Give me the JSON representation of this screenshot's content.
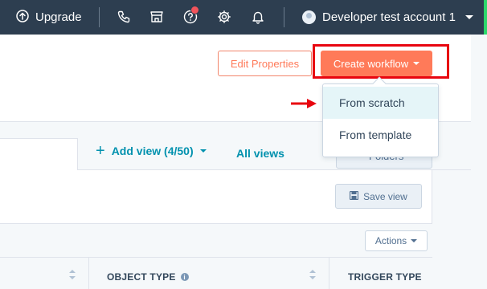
{
  "topnav": {
    "upgrade_label": "Upgrade",
    "account_name": "Developer test account 1",
    "icons": [
      "arrow-circle-up-icon",
      "phone-icon",
      "marketplace-icon",
      "help-icon",
      "settings-icon",
      "bell-icon",
      "avatar"
    ],
    "colors": {
      "background": "#2d3e50",
      "notification_dot": "#f2545b",
      "edge": "#2bd96b"
    }
  },
  "header": {
    "edit_properties_label": "Edit Properties",
    "create_workflow_label": "Create workflow",
    "highlight_color": "#e8050f",
    "accent": "#ff7a59"
  },
  "dropdown": {
    "items": [
      {
        "label": "From scratch",
        "active": true
      },
      {
        "label": "From template",
        "active": false
      }
    ]
  },
  "views": {
    "add_view_label": "Add view (4/50)",
    "all_views_label": "All views",
    "folders_label": "Folders",
    "link_color": "#0091ae"
  },
  "toolbar": {
    "save_view_label": "Save view",
    "actions_label": "Actions"
  },
  "table": {
    "columns": [
      "OBJECT TYPE",
      "TRIGGER TYPE"
    ]
  }
}
